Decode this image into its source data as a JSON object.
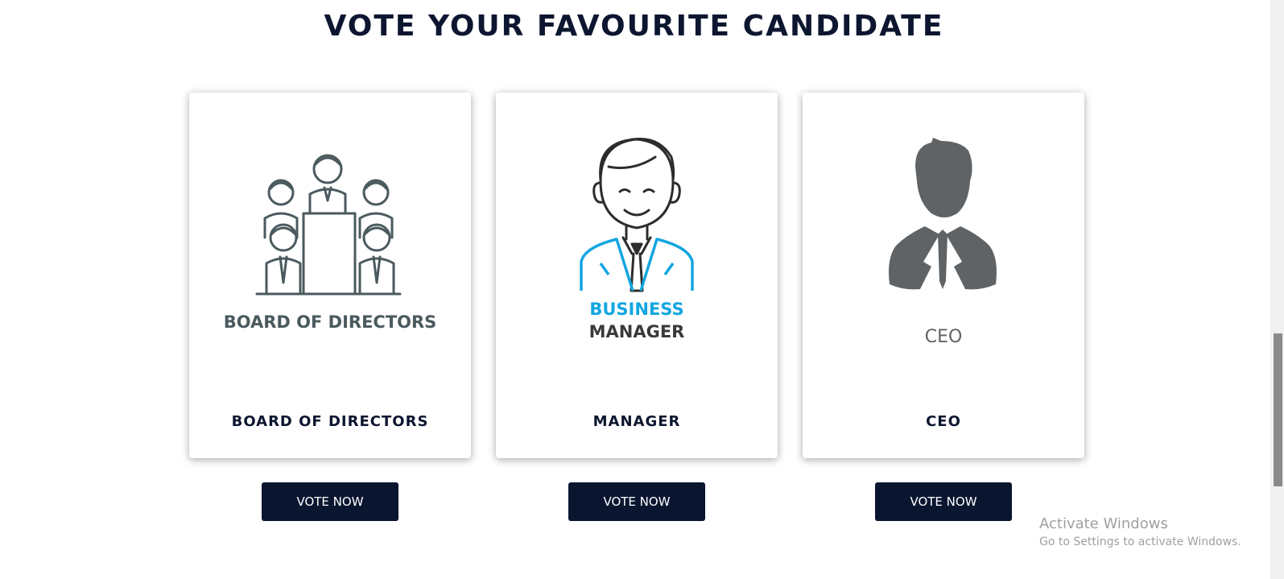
{
  "heading": "VOTE YOUR FAVOURITE CANDIDATE",
  "cards": [
    {
      "image_text": "BOARD OF DIRECTORS",
      "name": "BOARD OF DIRECTORS",
      "button": "VOTE NOW",
      "icon": "board-of-directors-icon"
    },
    {
      "image_text_line1": "BUSINESS",
      "image_text_line2": "MANAGER",
      "name": "MANAGER",
      "button": "VOTE NOW",
      "icon": "business-manager-icon"
    },
    {
      "image_text": "CEO",
      "name": "CEO",
      "button": "VOTE NOW",
      "icon": "ceo-silhouette-icon"
    }
  ],
  "watermark": {
    "line1": "Activate Windows",
    "line2": "Go to Settings to activate Windows."
  },
  "colors": {
    "navy": "#0a1530",
    "icon_gray": "#4a5a5e",
    "accent_blue": "#12a6e0",
    "silhouette": "#5f6366"
  }
}
